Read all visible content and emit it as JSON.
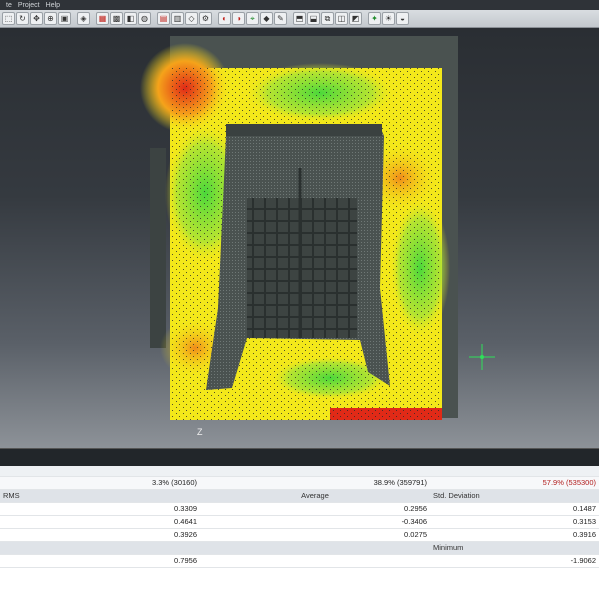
{
  "menu": {
    "items": [
      "te",
      "Project",
      "Help"
    ]
  },
  "toolbar": {
    "buttons": [
      {
        "icon": "select-icon",
        "glyph": "⬚"
      },
      {
        "icon": "rotate-icon",
        "glyph": "↻"
      },
      {
        "icon": "pan-icon",
        "glyph": "✥"
      },
      {
        "icon": "zoom-icon",
        "glyph": "⊕"
      },
      {
        "icon": "cube-icon",
        "glyph": "▣"
      },
      {
        "icon": "sep",
        "glyph": ""
      },
      {
        "icon": "view-icon",
        "glyph": "◈"
      },
      {
        "icon": "sep",
        "glyph": ""
      },
      {
        "icon": "points-icon",
        "glyph": "▦"
      },
      {
        "icon": "mesh-icon",
        "glyph": "▩"
      },
      {
        "icon": "object-icon",
        "glyph": "◧"
      },
      {
        "icon": "surface-icon",
        "glyph": "◍"
      },
      {
        "icon": "sep",
        "glyph": ""
      },
      {
        "icon": "save-icon",
        "glyph": "▤"
      },
      {
        "icon": "grid-icon",
        "glyph": "▥"
      },
      {
        "icon": "align-icon",
        "glyph": "◇"
      },
      {
        "icon": "register-icon",
        "glyph": "⚙"
      },
      {
        "icon": "sep",
        "glyph": ""
      },
      {
        "icon": "compare-icon",
        "glyph": "◐"
      },
      {
        "icon": "deviation-icon",
        "glyph": "◑"
      },
      {
        "icon": "measure-icon",
        "glyph": "⌖"
      },
      {
        "icon": "section-icon",
        "glyph": "◆"
      },
      {
        "icon": "probe-icon",
        "glyph": "✎"
      },
      {
        "icon": "sep",
        "glyph": ""
      },
      {
        "icon": "frame-icon",
        "glyph": "⬒"
      },
      {
        "icon": "fit-icon",
        "glyph": "⬓"
      },
      {
        "icon": "box-icon",
        "glyph": "⧉"
      },
      {
        "icon": "clip-icon",
        "glyph": "◫"
      },
      {
        "icon": "fill-icon",
        "glyph": "◩"
      },
      {
        "icon": "sep",
        "glyph": ""
      },
      {
        "icon": "bulb-icon",
        "glyph": "✦"
      },
      {
        "icon": "light-icon",
        "glyph": "☀"
      },
      {
        "icon": "shade-icon",
        "glyph": "◒"
      }
    ]
  },
  "viewport": {
    "axis_label": "Z",
    "colors": {
      "red": "#e02a17",
      "orange": "#f5a31a",
      "yellow": "#f3e81a",
      "green": "#4ad83b",
      "mesh": "#4a5250",
      "crosshair": "#2fe05a"
    }
  },
  "stats": {
    "percentages": [
      {
        "value": "3.3% (30160)",
        "color": "#b21d1d"
      },
      {
        "value": "38.9% (359791)",
        "color": "#222222"
      },
      {
        "value": "57.9% (535300)",
        "color": "#222222"
      }
    ],
    "col_rms": "RMS",
    "col_average": "Average",
    "col_std": "Std. Deviation",
    "rows": [
      {
        "rms": "0.3309",
        "avg": "0.2956",
        "std": "0.1487"
      },
      {
        "rms": "0.4641",
        "avg": "-0.3406",
        "std": "0.3153"
      },
      {
        "rms": "0.3926",
        "avg": "0.0275",
        "std": "0.3916"
      }
    ],
    "col_minimum": "Minimum",
    "min_row": {
      "left": "0.7956",
      "right": "-1.9062"
    }
  }
}
